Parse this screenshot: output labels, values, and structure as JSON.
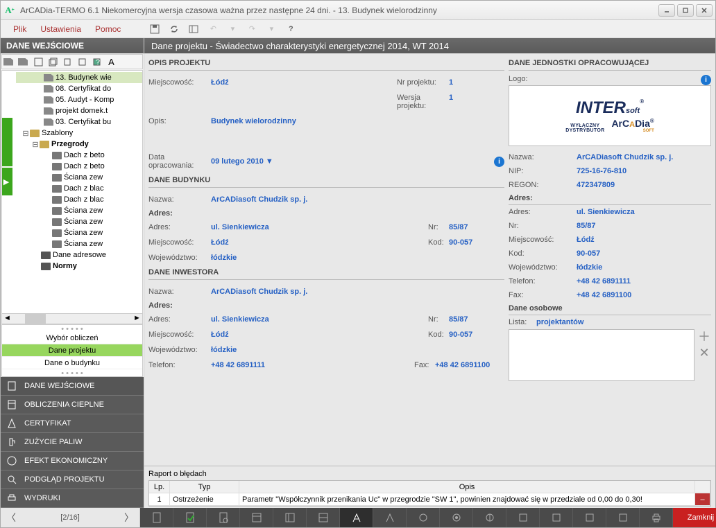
{
  "window": {
    "title": "ArCADia-TERMO 6.1 Niekomercyjna wersja czasowa ważna przez następne 24 dni. - 13. Budynek wielorodzinny"
  },
  "menu": {
    "file": "Plik",
    "settings": "Ustawienia",
    "help": "Pomoc"
  },
  "left": {
    "header": "DANE WEJŚCIOWE",
    "tree": {
      "items": [
        "13. Budynek wie",
        "08. Certyfikat do",
        "05. Audyt - Komp",
        "projekt domek.t",
        "03. Certyfikat bu"
      ],
      "szablony": "Szablony",
      "przegrody": "Przegrody",
      "pitems": [
        "Dach z beto",
        "Dach z beto",
        "Ściana zew",
        "Dach z blac",
        "Dach z blac",
        "Ściana zew",
        "Ściana zew",
        "Ściana zew",
        "Ściana zew"
      ],
      "adresowe": "Dane adresowe",
      "normy": "Normy"
    },
    "nav": {
      "i1": "Wybór obliczeń",
      "i2": "Dane projektu",
      "i3": "Dane o budynku"
    },
    "btm": {
      "b1": "DANE WEJŚCIOWE",
      "b2": "OBLICZENIA CIEPLNE",
      "b3": "CERTYFIKAT",
      "b4": "ZUŻYCIE PALIW",
      "b5": "EFEKT EKONOMICZNY",
      "b6": "PODGLĄD PROJEKTU",
      "b7": "WYDRUKI"
    }
  },
  "right": {
    "header": "Dane projektu - Świadectwo charakterystyki energetycznej 2014, WT 2014",
    "opis_projektu": {
      "hdr": "OPIS PROJEKTU",
      "miejscowosc_l": "Miejscowość:",
      "miejscowosc_v": "Łódź",
      "nr_l": "Nr projektu:",
      "nr_v": "1",
      "wer_l": "Wersja projektu:",
      "wer_v": "1",
      "opis_l": "Opis:",
      "opis_v": "Budynek wielorodzinny",
      "data_l": "Data opracowania:",
      "data_v": "09  lutego 2010  ▼"
    },
    "dane_budynku": {
      "hdr": "DANE BUDYNKU",
      "nazwa_l": "Nazwa:",
      "nazwa_v": "ArCADiasoft Chudzik sp. j.",
      "adres_h": "Adres:",
      "adres_l": "Adres:",
      "adres_v": "ul. Sienkiewicza",
      "nr_l": "Nr:",
      "nr_v": "85/87",
      "miej_l": "Miejscowość:",
      "miej_v": "Łódź",
      "kod_l": "Kod:",
      "kod_v": "90-057",
      "woj_l": "Województwo:",
      "woj_v": "łódzkie"
    },
    "dane_inwestora": {
      "hdr": "DANE INWESTORA",
      "nazwa_l": "Nazwa:",
      "nazwa_v": "ArCADiasoft Chudzik sp. j.",
      "adres_h": "Adres:",
      "adres_l": "Adres:",
      "adres_v": "ul. Sienkiewicza",
      "nr_l": "Nr:",
      "nr_v": "85/87",
      "miej_l": "Miejscowość:",
      "miej_v": "Łódź",
      "kod_l": "Kod:",
      "kod_v": "90-057",
      "woj_l": "Województwo:",
      "woj_v": "łódzkie",
      "tel_l": "Telefon:",
      "tel_v": "+48 42 6891111",
      "fax_l": "Fax:",
      "fax_v": "+48 42 6891100"
    },
    "jednostka": {
      "hdr": "DANE JEDNOSTKI OPRACOWUJĄCEJ",
      "logo_l": "Logo:",
      "nazwa_l": "Nazwa:",
      "nazwa_v": "ArCADiasoft Chudzik sp. j.",
      "nip_l": "NIP:",
      "nip_v": "725-16-76-810",
      "regon_l": "REGON:",
      "regon_v": "472347809",
      "adres_h": "Adres:",
      "adres_l": "Adres:",
      "adres_v": "ul. Sienkiewicza",
      "nr_l": "Nr:",
      "nr_v": "85/87",
      "miej_l": "Miejscowość:",
      "miej_v": "Łódź",
      "kod_l": "Kod:",
      "kod_v": "90-057",
      "woj_l": "Województwo:",
      "woj_v": "łódzkie",
      "tel_l": "Telefon:",
      "tel_v": "+48 42 6891111",
      "fax_l": "Fax:",
      "fax_v": "+48 42 6891100",
      "osobowe_h": "Dane osobowe",
      "lista_l": "Lista:",
      "lista_v": "projektantów"
    },
    "report": {
      "title": "Raport o błędach",
      "lp_h": "Lp.",
      "typ_h": "Typ",
      "opis_h": "Opis",
      "rows": [
        {
          "lp": "1",
          "typ": "Ostrzeżenie",
          "opis": "Parametr \"Współczynnik przenikania Uc\" w przegrodzie \"SW 1\", powinien znajdować się w przedziale od 0,00 do 0,30!"
        }
      ]
    }
  },
  "footer": {
    "page": "[2/16]",
    "close": "Zamknij"
  }
}
